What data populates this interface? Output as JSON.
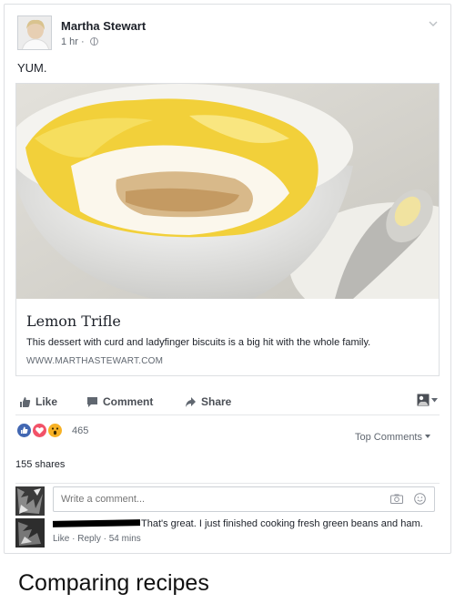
{
  "post": {
    "author": "Martha Stewart",
    "time": "1 hr",
    "separator": "·",
    "text": "YUM."
  },
  "link_preview": {
    "title": "Lemon Trifle",
    "description": "This dessert with curd and ladyfinger biscuits is a big hit with the whole family.",
    "domain": "WWW.MARTHASTEWART.COM"
  },
  "actions": {
    "like": "Like",
    "comment": "Comment",
    "share": "Share"
  },
  "reactions": {
    "count": "465",
    "sort_label": "Top Comments",
    "types": [
      "like-reaction",
      "love-reaction",
      "wow-reaction"
    ]
  },
  "shares": "155 shares",
  "comment_box": {
    "placeholder": "Write a comment..."
  },
  "comment": {
    "text": "That's great. I just finished cooking fresh green beans and ham.",
    "like": "Like",
    "reply": "Reply",
    "time": "54 mins",
    "dot": "·"
  },
  "caption": "Comparing recipes",
  "colors": {
    "link_blue": "#4267b2",
    "love_red": "#f25268",
    "wow_yellow": "#f7b125",
    "secondary_text": "#606770"
  }
}
